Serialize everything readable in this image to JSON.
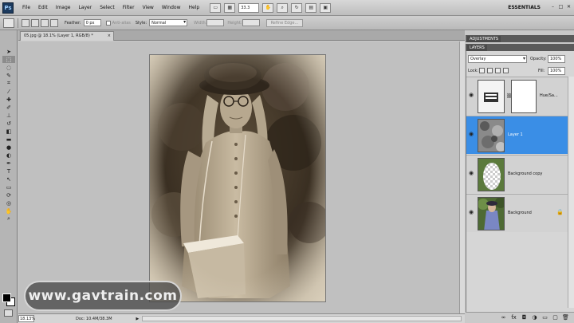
{
  "menubar": {
    "logo": "Ps",
    "items": [
      "File",
      "Edit",
      "Image",
      "Layer",
      "Select",
      "Filter",
      "View",
      "Window",
      "Help"
    ],
    "zoom": "33.3",
    "workspace": "ESSENTIALS",
    "win_controls": [
      "–",
      "□",
      "✕"
    ]
  },
  "options": {
    "feather_label": "Feather:",
    "feather_value": "0 px",
    "antialias_label": "Anti-alias",
    "style_label": "Style:",
    "style_value": "Normal",
    "width_label": "Width:",
    "height_label": "Height:",
    "refine_label": "Refine Edge..."
  },
  "document": {
    "tab_title": "05.jpg @ 18.1% (Layer 1, RGB/8) *",
    "tab_close": "×"
  },
  "statusbar": {
    "zoom": "18.13%",
    "doc_info": "Doc: 10.4M/38.3M",
    "arrow": "▶"
  },
  "watermark": "www.gavtrain.com",
  "panels": {
    "adjustments_tab": "ADJUSTMENTS",
    "layers_tab": "LAYERS",
    "blend_mode": "Overlay",
    "opacity_label": "Opacity:",
    "opacity_value": "100%",
    "lock_label": "Lock:",
    "fill_label": "Fill:",
    "fill_value": "100%"
  },
  "layers": [
    {
      "name": "Hue/Sa...",
      "type": "adjustment",
      "selected": false
    },
    {
      "name": "Layer 1",
      "type": "texture",
      "selected": true
    },
    {
      "name": "Background copy",
      "type": "masked",
      "selected": false
    },
    {
      "name": "Background",
      "type": "photo",
      "selected": false,
      "locked": true
    }
  ],
  "colors": {
    "selection": "#3a8ee6",
    "sepia_dark": "#3a2f22",
    "sepia_light": "#c9bba2"
  }
}
